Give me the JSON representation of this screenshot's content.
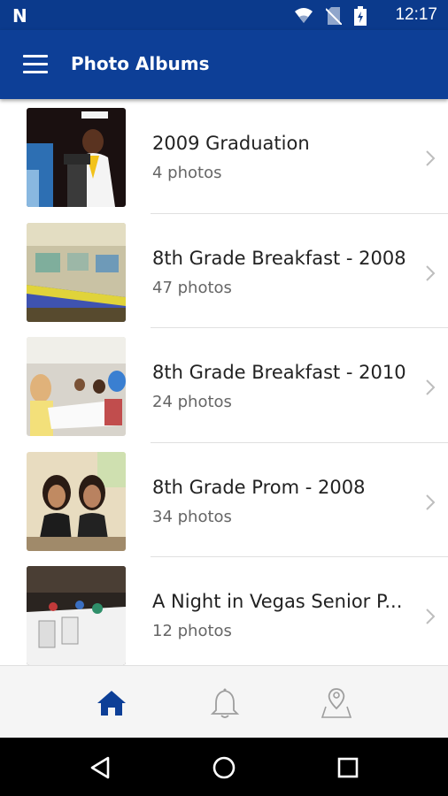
{
  "status_bar": {
    "time": "12:17",
    "icons": [
      "n-logo-icon",
      "wifi-icon",
      "no-sim-icon",
      "battery-charging-icon"
    ]
  },
  "app_bar": {
    "title": "Photo Albums",
    "menu_icon": "hamburger-menu-icon"
  },
  "albums": [
    {
      "title": "2009 Graduation",
      "count": "4 photos"
    },
    {
      "title": "8th Grade Breakfast - 2008",
      "count": "47 photos"
    },
    {
      "title": "8th Grade Breakfast - 2010",
      "count": "24 photos"
    },
    {
      "title": "8th Grade Prom - 2008",
      "count": "34 photos"
    },
    {
      "title": "A Night in Vegas Senior P...",
      "count": "12 photos"
    }
  ],
  "bottom_nav": {
    "items": [
      "home-icon",
      "bell-icon",
      "map-pin-icon"
    ],
    "active_color": "#0d3f97",
    "inactive_color": "#9e9e9e"
  },
  "system_nav": [
    "back-icon",
    "home-circle-icon",
    "recents-icon"
  ]
}
